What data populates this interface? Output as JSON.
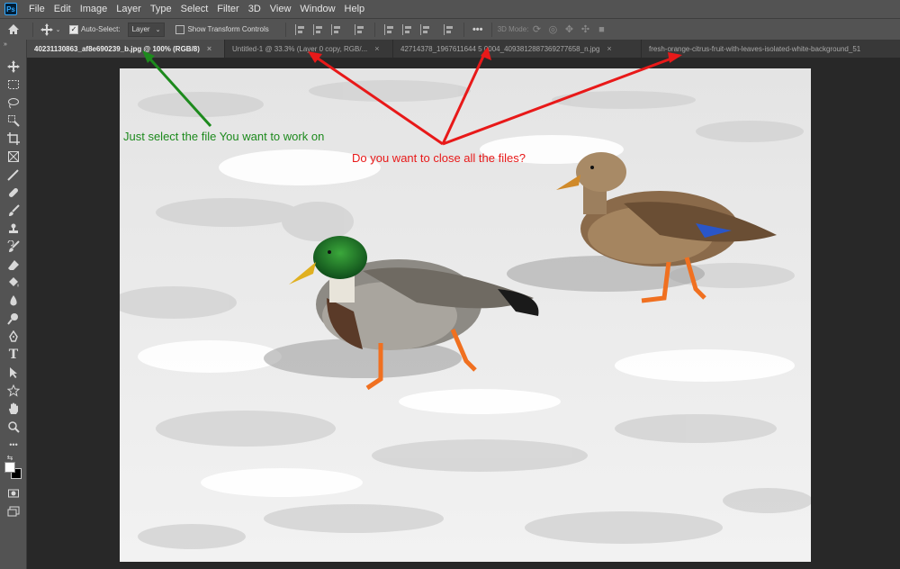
{
  "app": {
    "logo": "Ps",
    "name": "Adobe Photoshop"
  },
  "menu": [
    "File",
    "Edit",
    "Image",
    "Layer",
    "Type",
    "Select",
    "Filter",
    "3D",
    "View",
    "Window",
    "Help"
  ],
  "options": {
    "auto_select_label": "Auto-Select:",
    "auto_select_checked": true,
    "auto_select_target": "Layer",
    "show_transform_label": "Show Transform Controls",
    "show_transform_checked": false,
    "more_label": "•••",
    "mode_3d_label": "3D Mode:"
  },
  "tabs": [
    {
      "label": "40231130863_af8e690239_b.jpg @ 100% (RGB/8)",
      "active": true
    },
    {
      "label": "Untitled-1 @ 33.3% (Layer 0 copy, RGB/...",
      "active": false
    },
    {
      "label": "42714378_1967611644 5 0004_4093812887369277658_n.jpg",
      "active": false
    },
    {
      "label": "fresh-orange-citrus-fruit-with-leaves-isolated-white-background_51",
      "active": false
    }
  ],
  "tools": [
    "move-icon",
    "marquee-icon",
    "lasso-icon",
    "quick-select-icon",
    "crop-icon",
    "frame-icon",
    "eyedropper-icon",
    "healing-icon",
    "brush-icon",
    "stamp-icon",
    "history-brush-icon",
    "eraser-icon",
    "paint-bucket-icon",
    "blur-icon",
    "dodge-icon",
    "pen-icon",
    "type-icon",
    "path-select-icon",
    "shape-icon",
    "hand-icon",
    "zoom-icon",
    "more-tools-icon",
    "color-swap-icon",
    "foreground-color",
    "quick-mask-icon",
    "screen-mode-icon"
  ],
  "colors": {
    "foreground": "#ffffff",
    "background": "#000000",
    "annotation_green": "#1d8a1d",
    "annotation_red": "#e81919",
    "ui_panel": "#535353"
  },
  "annotations": {
    "green_text": "Just select the file You want to work on",
    "red_text": "Do you want to close all the files?"
  }
}
